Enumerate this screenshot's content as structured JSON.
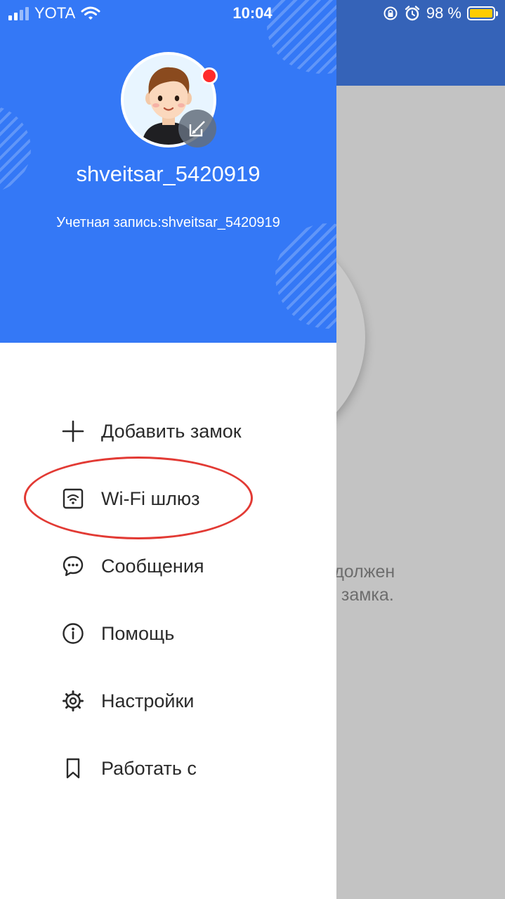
{
  "status_bar": {
    "carrier": "YOTA",
    "time": "10:04",
    "battery_percent": "98 %"
  },
  "background": {
    "text_line1": "фон должен",
    "text_line2": "ов от замка."
  },
  "profile": {
    "username": "shveitsar_5420919",
    "account": "Учетная запись:shveitsar_5420919"
  },
  "menu": {
    "add_lock": "Добавить замок",
    "wifi_gateway": "Wi-Fi шлюз",
    "messages": "Сообщения",
    "help": "Помощь",
    "settings": "Настройки",
    "work_with": "Работать с"
  },
  "colors": {
    "header_blue": "#3478f6",
    "highlight_red": "#e23a34",
    "battery_yellow": "#ffcc00"
  }
}
